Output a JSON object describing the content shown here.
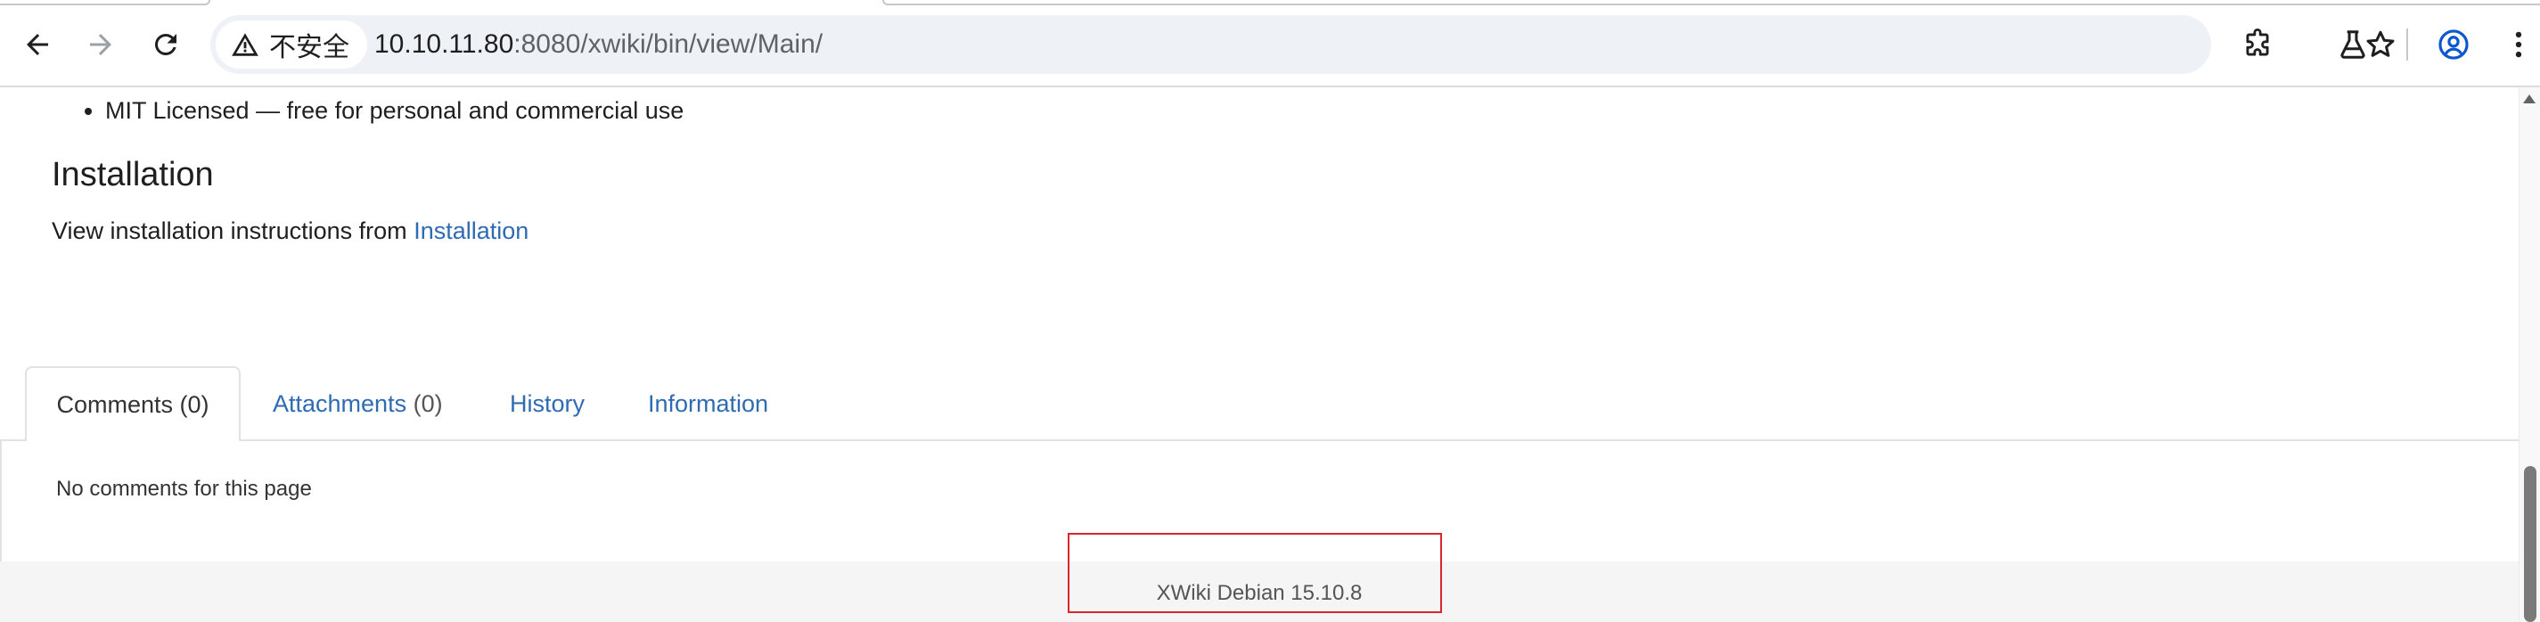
{
  "browser": {
    "security_label": "不安全",
    "url_host": "10.10.11.80",
    "url_path": ":8080/xwiki/bin/view/Main/",
    "icons": {
      "back": "back-arrow-icon",
      "forward": "forward-arrow-icon",
      "reload": "reload-icon",
      "security": "warning-icon",
      "bookmark": "star-icon",
      "extensions": "puzzle-icon",
      "labs": "flask-icon",
      "profile": "account-icon",
      "menu": "kebab-menu-icon"
    }
  },
  "content": {
    "bullets": [
      "MIT Licensed — free for personal and commercial use"
    ],
    "installation_heading": "Installation",
    "installation_text": "View installation instructions from ",
    "installation_link": "Installation"
  },
  "tabs": {
    "comments_label": "Comments",
    "comments_count": "(0)",
    "attachments_label": "Attachments",
    "attachments_count": "(0)",
    "history_label": "History",
    "information_label": "Information"
  },
  "comments_panel": {
    "empty_text": "No comments for this page"
  },
  "footer": {
    "version": "XWiki Debian 15.10.8"
  },
  "colors": {
    "link": "#2e6bb3",
    "highlight_box": "#d9262c",
    "footer_bg": "#f5f5f5"
  }
}
